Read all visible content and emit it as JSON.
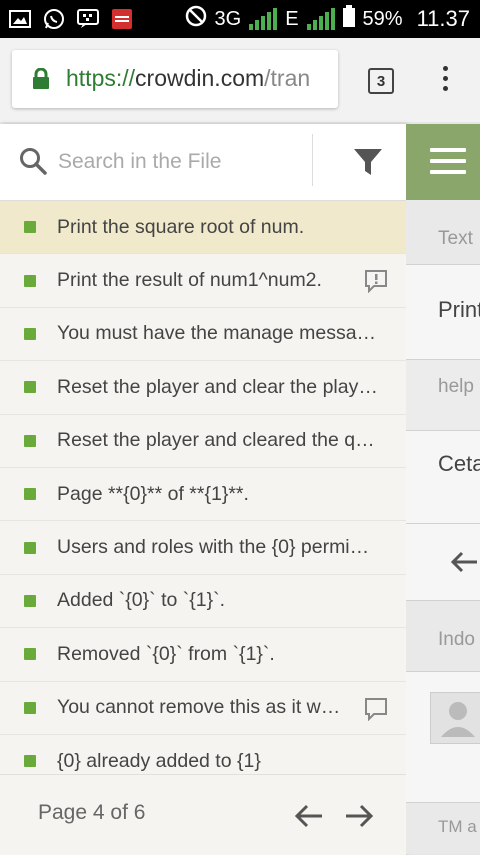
{
  "status_bar": {
    "network": "3G",
    "network2": "E",
    "battery": "59%",
    "time": "11.37"
  },
  "browser": {
    "url_scheme": "https://",
    "url_host": "crowdin.com",
    "url_path": "/tran",
    "tab_count": "3"
  },
  "search": {
    "placeholder": "Search in the File"
  },
  "strings": [
    {
      "text": "Print the square root of num.",
      "selected": true,
      "icon": ""
    },
    {
      "text": "Print the result of num1^num2.",
      "selected": false,
      "icon": "comment-alert-icon"
    },
    {
      "text": "You must have the manage messa…",
      "selected": false,
      "icon": ""
    },
    {
      "text": "Reset the player and clear the play…",
      "selected": false,
      "icon": ""
    },
    {
      "text": "Reset the player and cleared the q…",
      "selected": false,
      "icon": ""
    },
    {
      "text": "Page **{0}** of **{1}**.",
      "selected": false,
      "icon": ""
    },
    {
      "text": "Users and roles with the {0} permi…",
      "selected": false,
      "icon": ""
    },
    {
      "text": "Added `{0}` to `{1}`.",
      "selected": false,
      "icon": ""
    },
    {
      "text": "Removed `{0}` from `{1}`.",
      "selected": false,
      "icon": ""
    },
    {
      "text": "You cannot remove this as it w…",
      "selected": false,
      "icon": "comment-icon"
    },
    {
      "text": "{0} already added to {1}",
      "selected": false,
      "icon": ""
    }
  ],
  "pager": {
    "label": "Page 4 of 6"
  },
  "side_panel": {
    "text_label": "Text",
    "source_text": "Print",
    "help_label": "help",
    "translation": "Ceta",
    "language": "Indo",
    "tm_label": "TM a"
  },
  "colors": {
    "accent_green": "#6aaa3a",
    "header_green": "#8aa66a",
    "selected_row": "#f0e9cc"
  }
}
